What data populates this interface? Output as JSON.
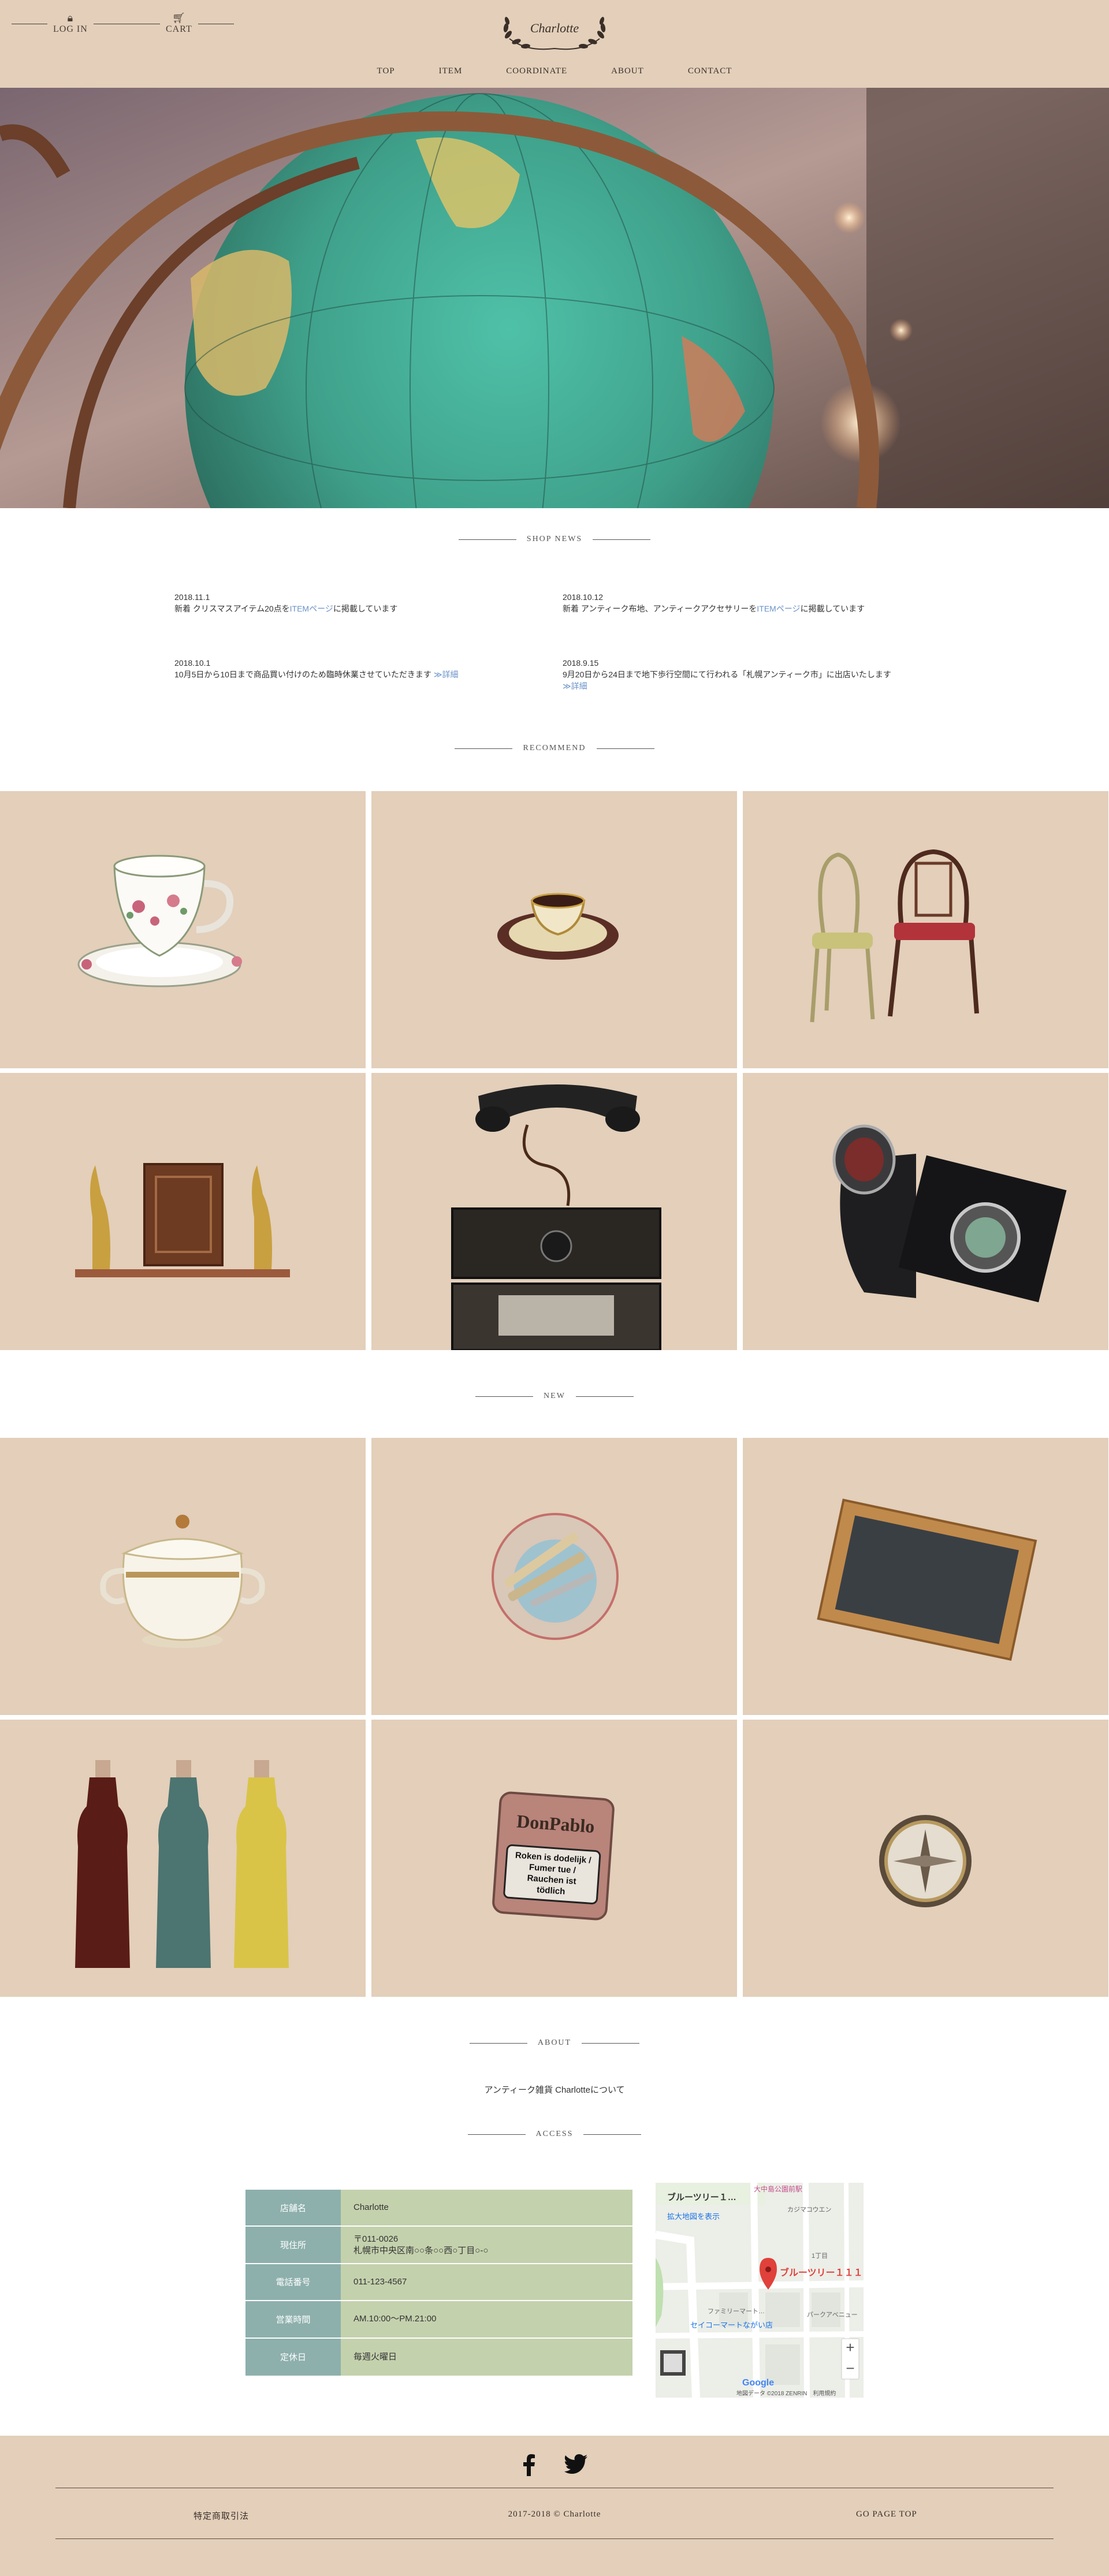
{
  "header": {
    "login_label": "LOG IN",
    "cart_label": "CART",
    "logo_text": "Charlotte",
    "nav": [
      "TOP",
      "ITEM",
      "COORDINATE",
      "ABOUT",
      "CONTACT"
    ]
  },
  "sections": {
    "shop_news": "SHOP NEWS",
    "recommend": "RECOMMEND",
    "new": "NEW",
    "about": "ABOUT",
    "access": "ACCESS"
  },
  "news": [
    {
      "date": "2018.11.1",
      "text_before": "新着 クリスマスアイテム20点を",
      "link": "ITEMページ",
      "text_after": "に掲載しています"
    },
    {
      "date": "2018.10.12",
      "text_before": "新着 アンティーク布地、アンティークアクセサリーを",
      "link": "ITEMページ",
      "text_after": "に掲載しています"
    },
    {
      "date": "2018.10.1",
      "text_before": "10月5日から10日まで商品買い付けのため臨時休業させていただきます",
      "link": "≫詳細",
      "text_after": ""
    },
    {
      "date": "2018.9.15",
      "text_before": "9月20日から24日まで地下歩行空間にて行われる「札幌アンティーク市」に出店いたします",
      "link": "≫詳細",
      "text_after": ""
    }
  ],
  "about_text": "アンティーク雑貨 Charlotteについて",
  "access": {
    "rows": [
      {
        "label": "店舗名",
        "value": "Charlotte"
      },
      {
        "label": "現住所",
        "value": "〒011-0026\n札幌市中央区南○○条○○西○丁目○-○"
      },
      {
        "label": "電話番号",
        "value": "011-123-4567"
      },
      {
        "label": "営業時間",
        "value": "AM.10:00～PM.21:00"
      },
      {
        "label": "定休日",
        "value": "毎週火曜日"
      }
    ]
  },
  "map": {
    "title": "ブルーツリー１…",
    "link": "拡大地図を表示",
    "pin_label": "ブルーツリー１１１",
    "place_1": "セイコーマートながい店",
    "place_2": "ファミリーマート…",
    "area_1": "カジマコウエン",
    "area_2": "1丁目",
    "area_3": "パークアベニュー",
    "top_label": "大中島公園前駅",
    "brand": "Google",
    "footer_text": "地図データ ©2018 ZENRIN　利用規約",
    "zoom_in": "+",
    "zoom_out": "−"
  },
  "footer": {
    "legal": "特定商取引法",
    "copyright": "2017-2018 © Charlotte",
    "go_top": "GO PAGE TOP"
  },
  "items": {
    "product_labels": [
      "DonPablo",
      "Roken is dodelijk /",
      "Fumer tue /",
      "Rauchen ist",
      "tödlich"
    ]
  },
  "colors": {
    "beige": "#e3cfba",
    "teal": "#8db0ad",
    "sage": "#c4d1ad",
    "link": "#6a92c8"
  }
}
